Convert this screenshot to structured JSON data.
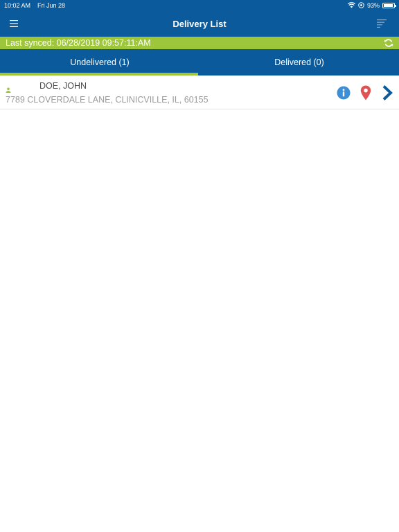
{
  "status_bar": {
    "time": "10:02 AM",
    "date": "Fri Jun 28",
    "battery_text": "93%",
    "battery_level": 0.93
  },
  "header": {
    "title": "Delivery List",
    "menu_icon": "hamburger-menu-icon",
    "sort_icon": "sort-lines-icon"
  },
  "sync": {
    "text": "Last synced: 06/28/2019 09:57:11:AM",
    "icon": "refresh-icon"
  },
  "tabs": [
    {
      "label": "Undelivered (1)",
      "selected": true
    },
    {
      "label": "Delivered (0)",
      "selected": false
    }
  ],
  "deliveries": [
    {
      "name": "DOE, JOHN",
      "address": "7789 CLOVERDALE LANE, CLINICVILLE, IL, 60155",
      "icons": [
        "person-icon",
        "info-icon",
        "map-pin-icon",
        "chevron-right-icon"
      ]
    }
  ],
  "colors": {
    "primary": "#0b5b9c",
    "accent": "#9ec63b",
    "info": "#3c8fd6",
    "pin": "#e05353"
  }
}
